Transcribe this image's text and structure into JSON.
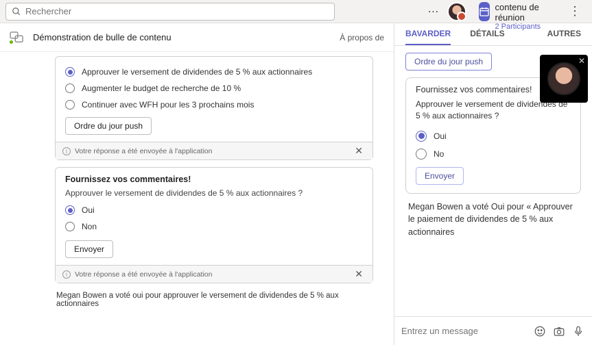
{
  "search": {
    "placeholder": "Rechercher"
  },
  "meeting": {
    "title": "Bulle de contenu de réunion",
    "participants": "2 Participants"
  },
  "left": {
    "title": "Démonstration de bulle de contenu",
    "tab_about": "À propos de",
    "card1": {
      "opt1": "Approuver le versement de dividendes de 5 % aux actionnaires",
      "opt2": "Augmenter le budget de recherche de 10 %",
      "opt3": "Continuer avec WFH pour les 3 prochains mois",
      "push_btn": "Ordre du jour push",
      "footer": "Votre réponse a été envoyée à l'application"
    },
    "card2": {
      "heading": "Fournissez vos commentaires!",
      "question": "Approuver le versement de dividendes de 5 % aux actionnaires ?",
      "yes": "Oui",
      "no": "Non",
      "send": "Envoyer",
      "footer": "Votre réponse a été envoyée à l'application"
    },
    "vote_line": "Megan Bowen a voté oui pour approuver le versement de dividendes de 5 % aux actionnaires"
  },
  "right": {
    "tabs": {
      "chat": "BAVARDER",
      "details": "DÉTAILS",
      "others": "AUTRES"
    },
    "push_btn": "Ordre du jour push",
    "card": {
      "heading": "Fournissez vos commentaires!",
      "question": "Approuver le versement de dividendes de 5 % aux actionnaires ?",
      "yes": "Oui",
      "no": "No",
      "send": "Envoyer"
    },
    "status": "Megan Bowen a voté Oui pour « Approuver le paiement de dividendes de 5 % aux actionnaires",
    "compose_placeholder": "Entrez un message"
  }
}
